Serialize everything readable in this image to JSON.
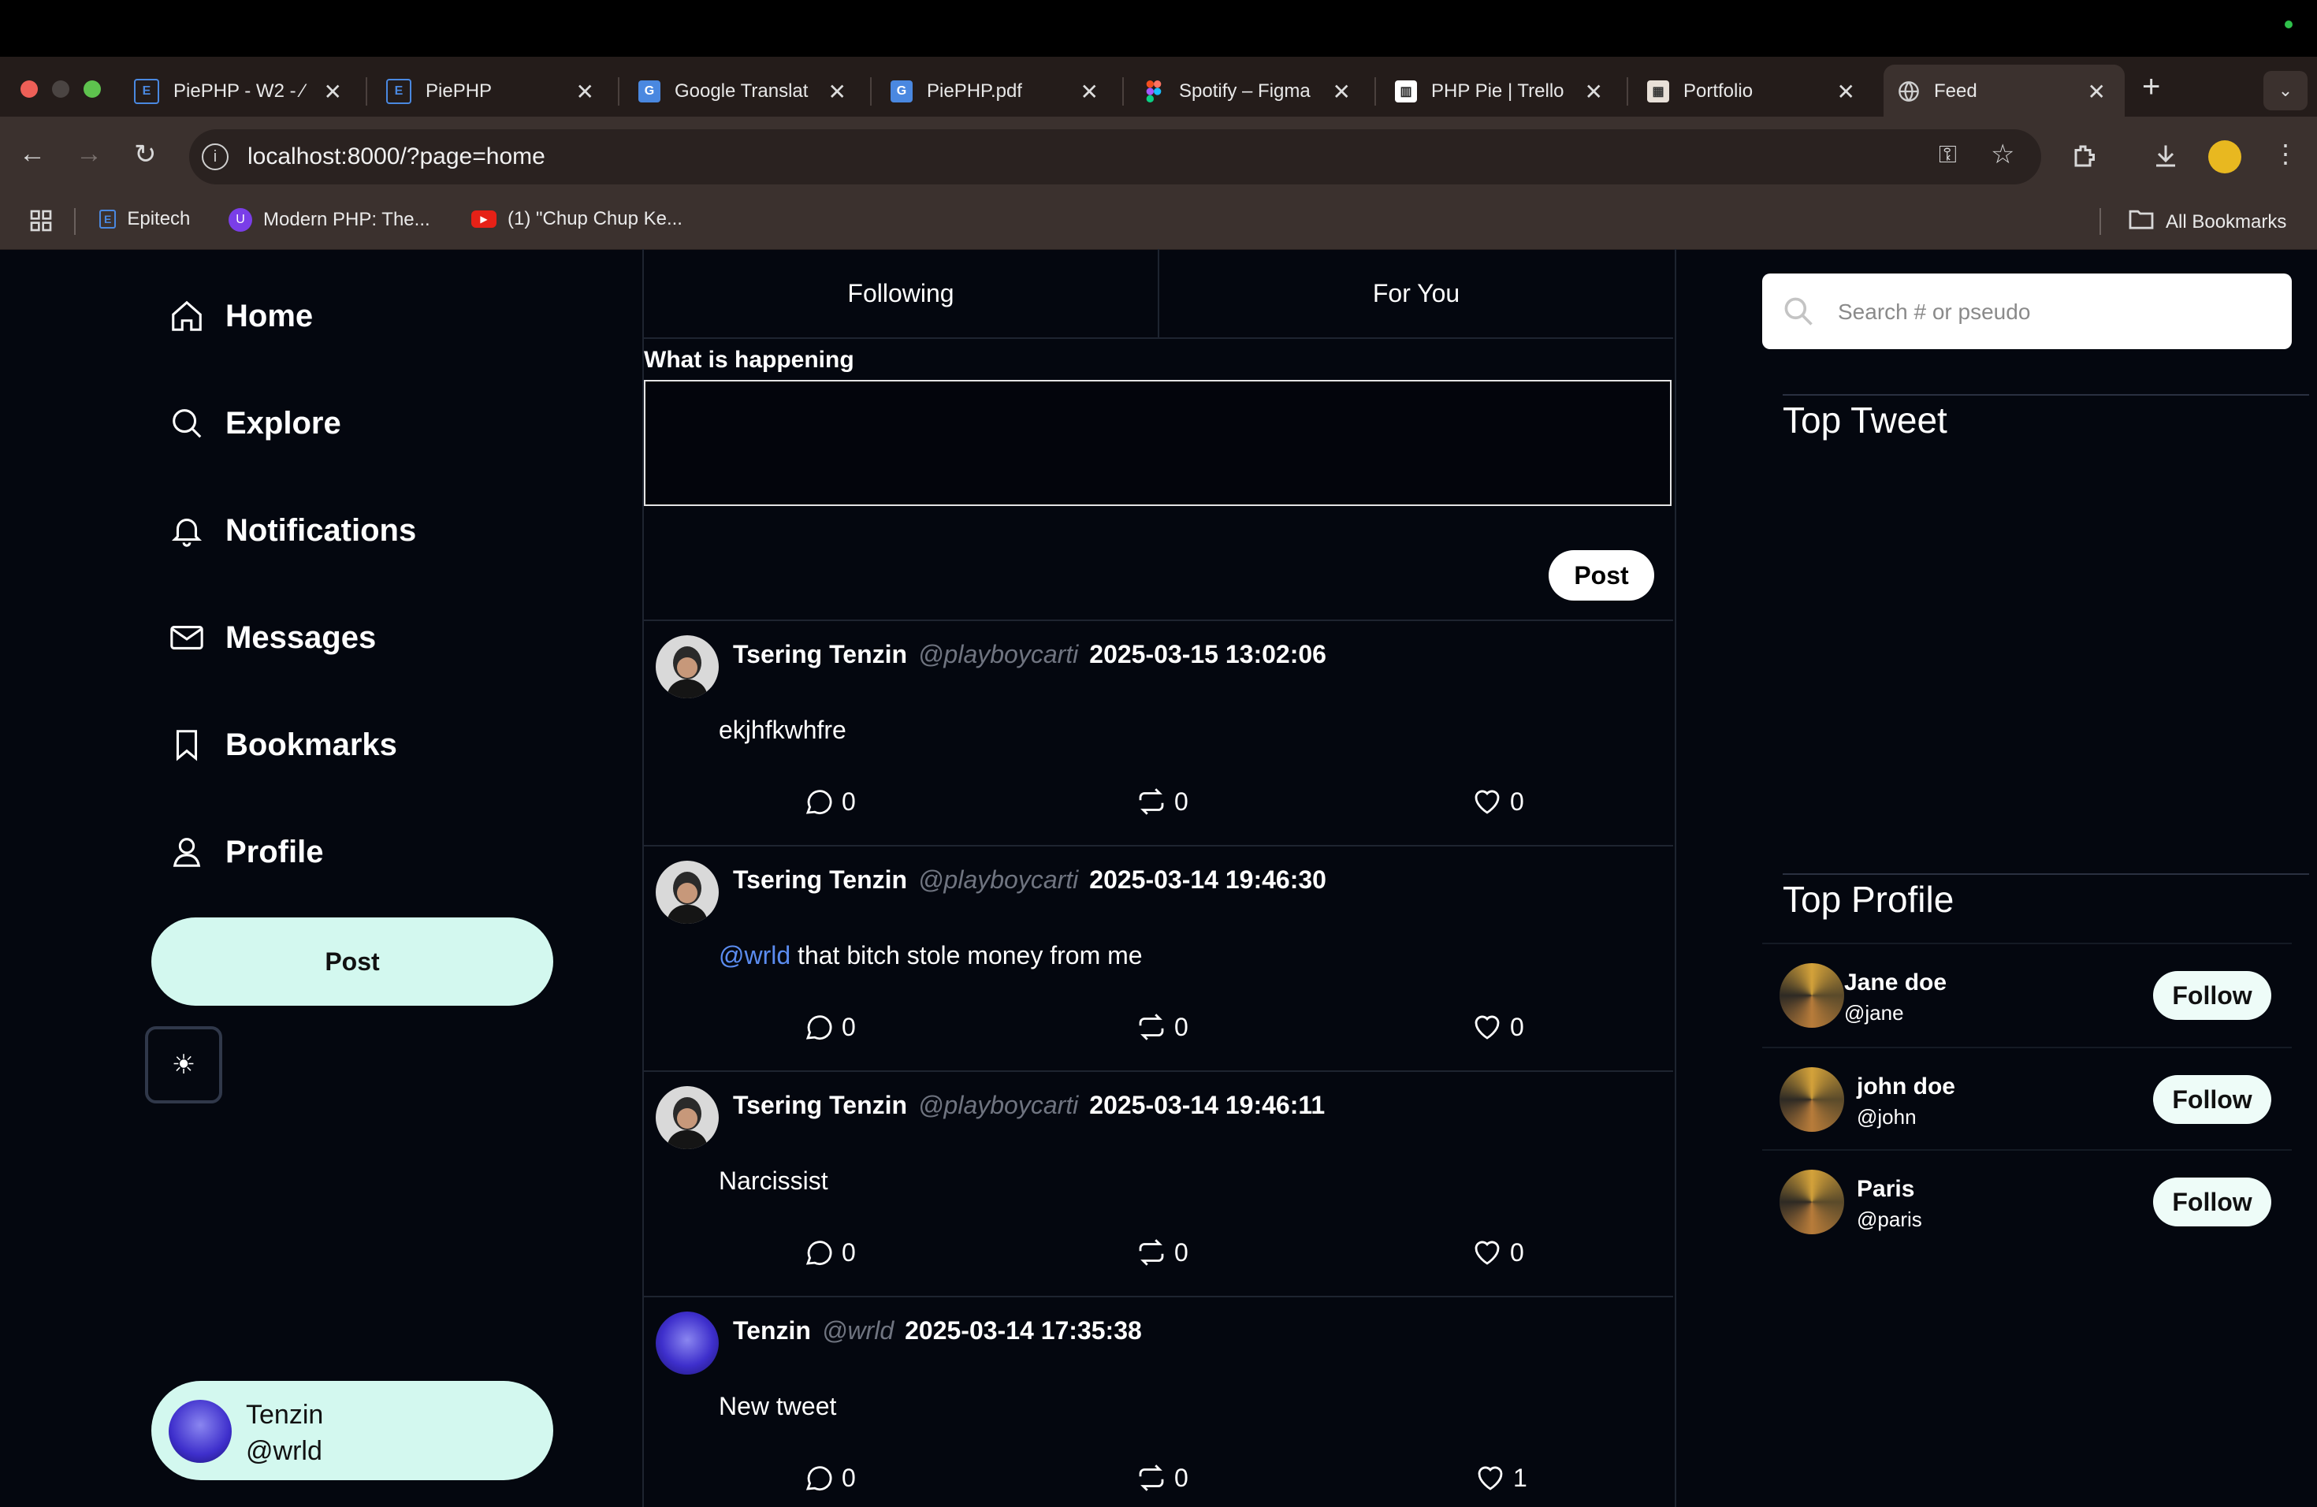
{
  "browser": {
    "tabs": [
      {
        "title": "PiePHP - W2 - ⁄",
        "icon": "epitech-icon"
      },
      {
        "title": "PiePHP",
        "icon": "epitech-icon"
      },
      {
        "title": "Google Translat",
        "icon": "google-translate-icon"
      },
      {
        "title": "PiePHP.pdf",
        "icon": "google-translate-icon"
      },
      {
        "title": "Spotify – Figma",
        "icon": "figma-icon"
      },
      {
        "title": "PHP Pie | Trello",
        "icon": "trello-icon"
      },
      {
        "title": "Portfolio",
        "icon": "portfolio-icon"
      },
      {
        "title": "Feed",
        "icon": "globe-icon",
        "active": true
      }
    ],
    "url": "localhost:8000/?page=home",
    "bookmarks": [
      "Epitech",
      "Modern PHP: The...",
      "(1) \"Chup Chup Ke..."
    ],
    "all_bookmarks": "All Bookmarks"
  },
  "sidebar": {
    "nav": [
      {
        "label": "Home",
        "icon": "home-icon"
      },
      {
        "label": "Explore",
        "icon": "search-icon"
      },
      {
        "label": "Notifications",
        "icon": "bell-icon"
      },
      {
        "label": "Messages",
        "icon": "mail-icon"
      },
      {
        "label": "Bookmarks",
        "icon": "bookmark-icon"
      },
      {
        "label": "Profile",
        "icon": "user-icon"
      }
    ],
    "post_label": "Post",
    "theme_icon": "sun-icon",
    "user": {
      "name": "Tenzin",
      "handle": "@wrld"
    }
  },
  "feed": {
    "tabs": [
      "Following",
      "For You"
    ],
    "compose_label": "What is happening",
    "compose_value": "",
    "post_label": "Post",
    "tweets": [
      {
        "name": "Tsering Tenzin",
        "handle": "@playboycarti",
        "date": "2025-03-15 13:02:06",
        "mention": "",
        "text": "ekjhfkwhfre",
        "comments": "0",
        "retweets": "0",
        "likes": "0"
      },
      {
        "name": "Tsering Tenzin",
        "handle": "@playboycarti",
        "date": "2025-03-14 19:46:30",
        "mention": "@wrld",
        "text": "that bitch stole money from me",
        "comments": "0",
        "retweets": "0",
        "likes": "0"
      },
      {
        "name": "Tsering Tenzin",
        "handle": "@playboycarti",
        "date": "2025-03-14 19:46:11",
        "mention": "",
        "text": "Narcissist",
        "comments": "0",
        "retweets": "0",
        "likes": "0"
      },
      {
        "name": "Tenzin",
        "handle": "@wrld",
        "date": "2025-03-14 17:35:38",
        "mention": "",
        "text": "New tweet",
        "comments": "0",
        "retweets": "0",
        "likes": "1"
      }
    ]
  },
  "right": {
    "search_placeholder": "Search # or pseudo",
    "top_tweet_title": "Top Tweet",
    "top_profile_title": "Top Profile",
    "follow_label": "Follow",
    "profiles": [
      {
        "name": "Jane doe",
        "handle": "@jane"
      },
      {
        "name": "john doe",
        "handle": "@john"
      },
      {
        "name": "Paris",
        "handle": "@paris"
      }
    ]
  },
  "colors": {
    "background": "#04070f",
    "accent": "#d3f8ef",
    "mention": "#5b8cf0"
  }
}
